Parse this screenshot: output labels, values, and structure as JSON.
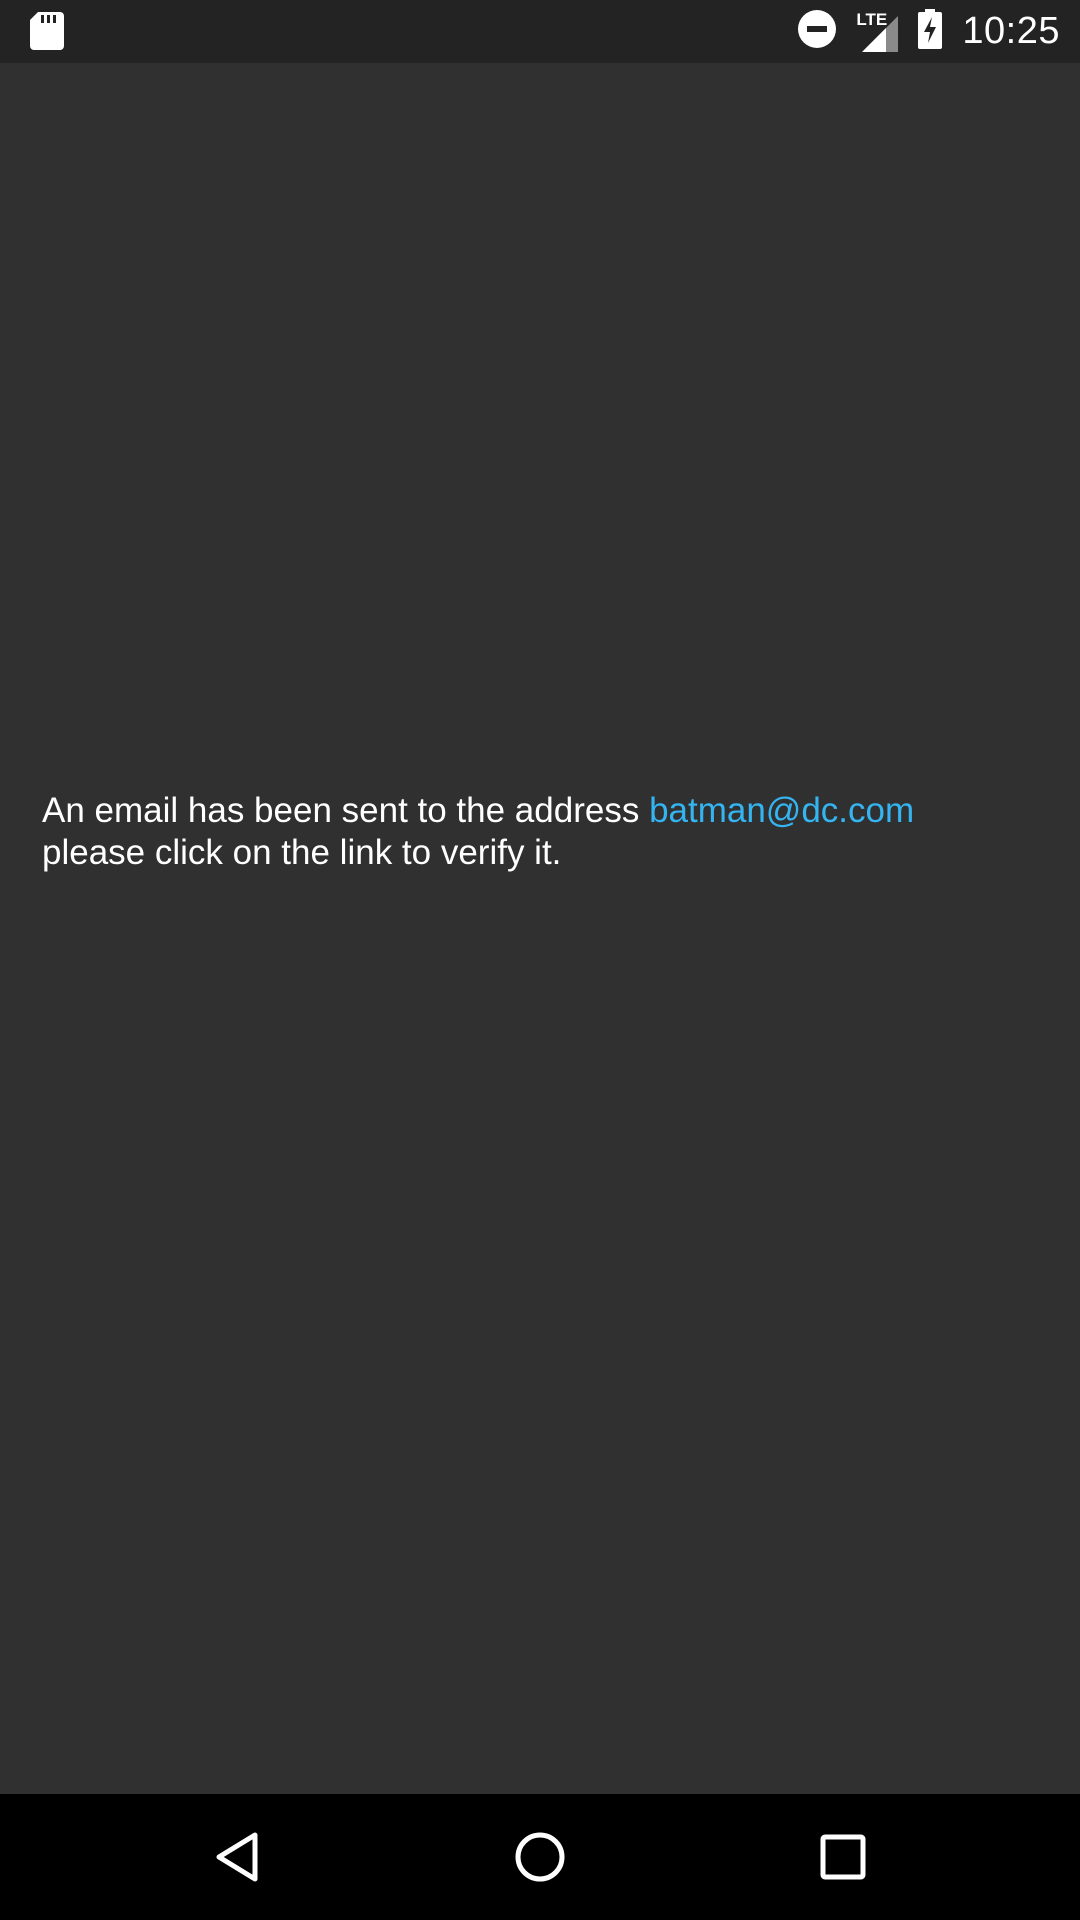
{
  "status_bar": {
    "time": "10:25",
    "network_label": "LTE",
    "icons": [
      "sd-card-icon",
      "do-not-disturb-icon",
      "signal-icon",
      "battery-charging-icon"
    ]
  },
  "message": {
    "text_before": "An email has been sent to the address ",
    "email": "batman@dc.com",
    "text_after": "please click on the link to verify it."
  },
  "nav_bar": {
    "buttons": [
      "back",
      "home",
      "recents"
    ]
  },
  "colors": {
    "background": "#303030",
    "status_bar": "#232323",
    "nav_bar": "#000000",
    "text": "#ffffff",
    "link": "#34b4f0"
  }
}
